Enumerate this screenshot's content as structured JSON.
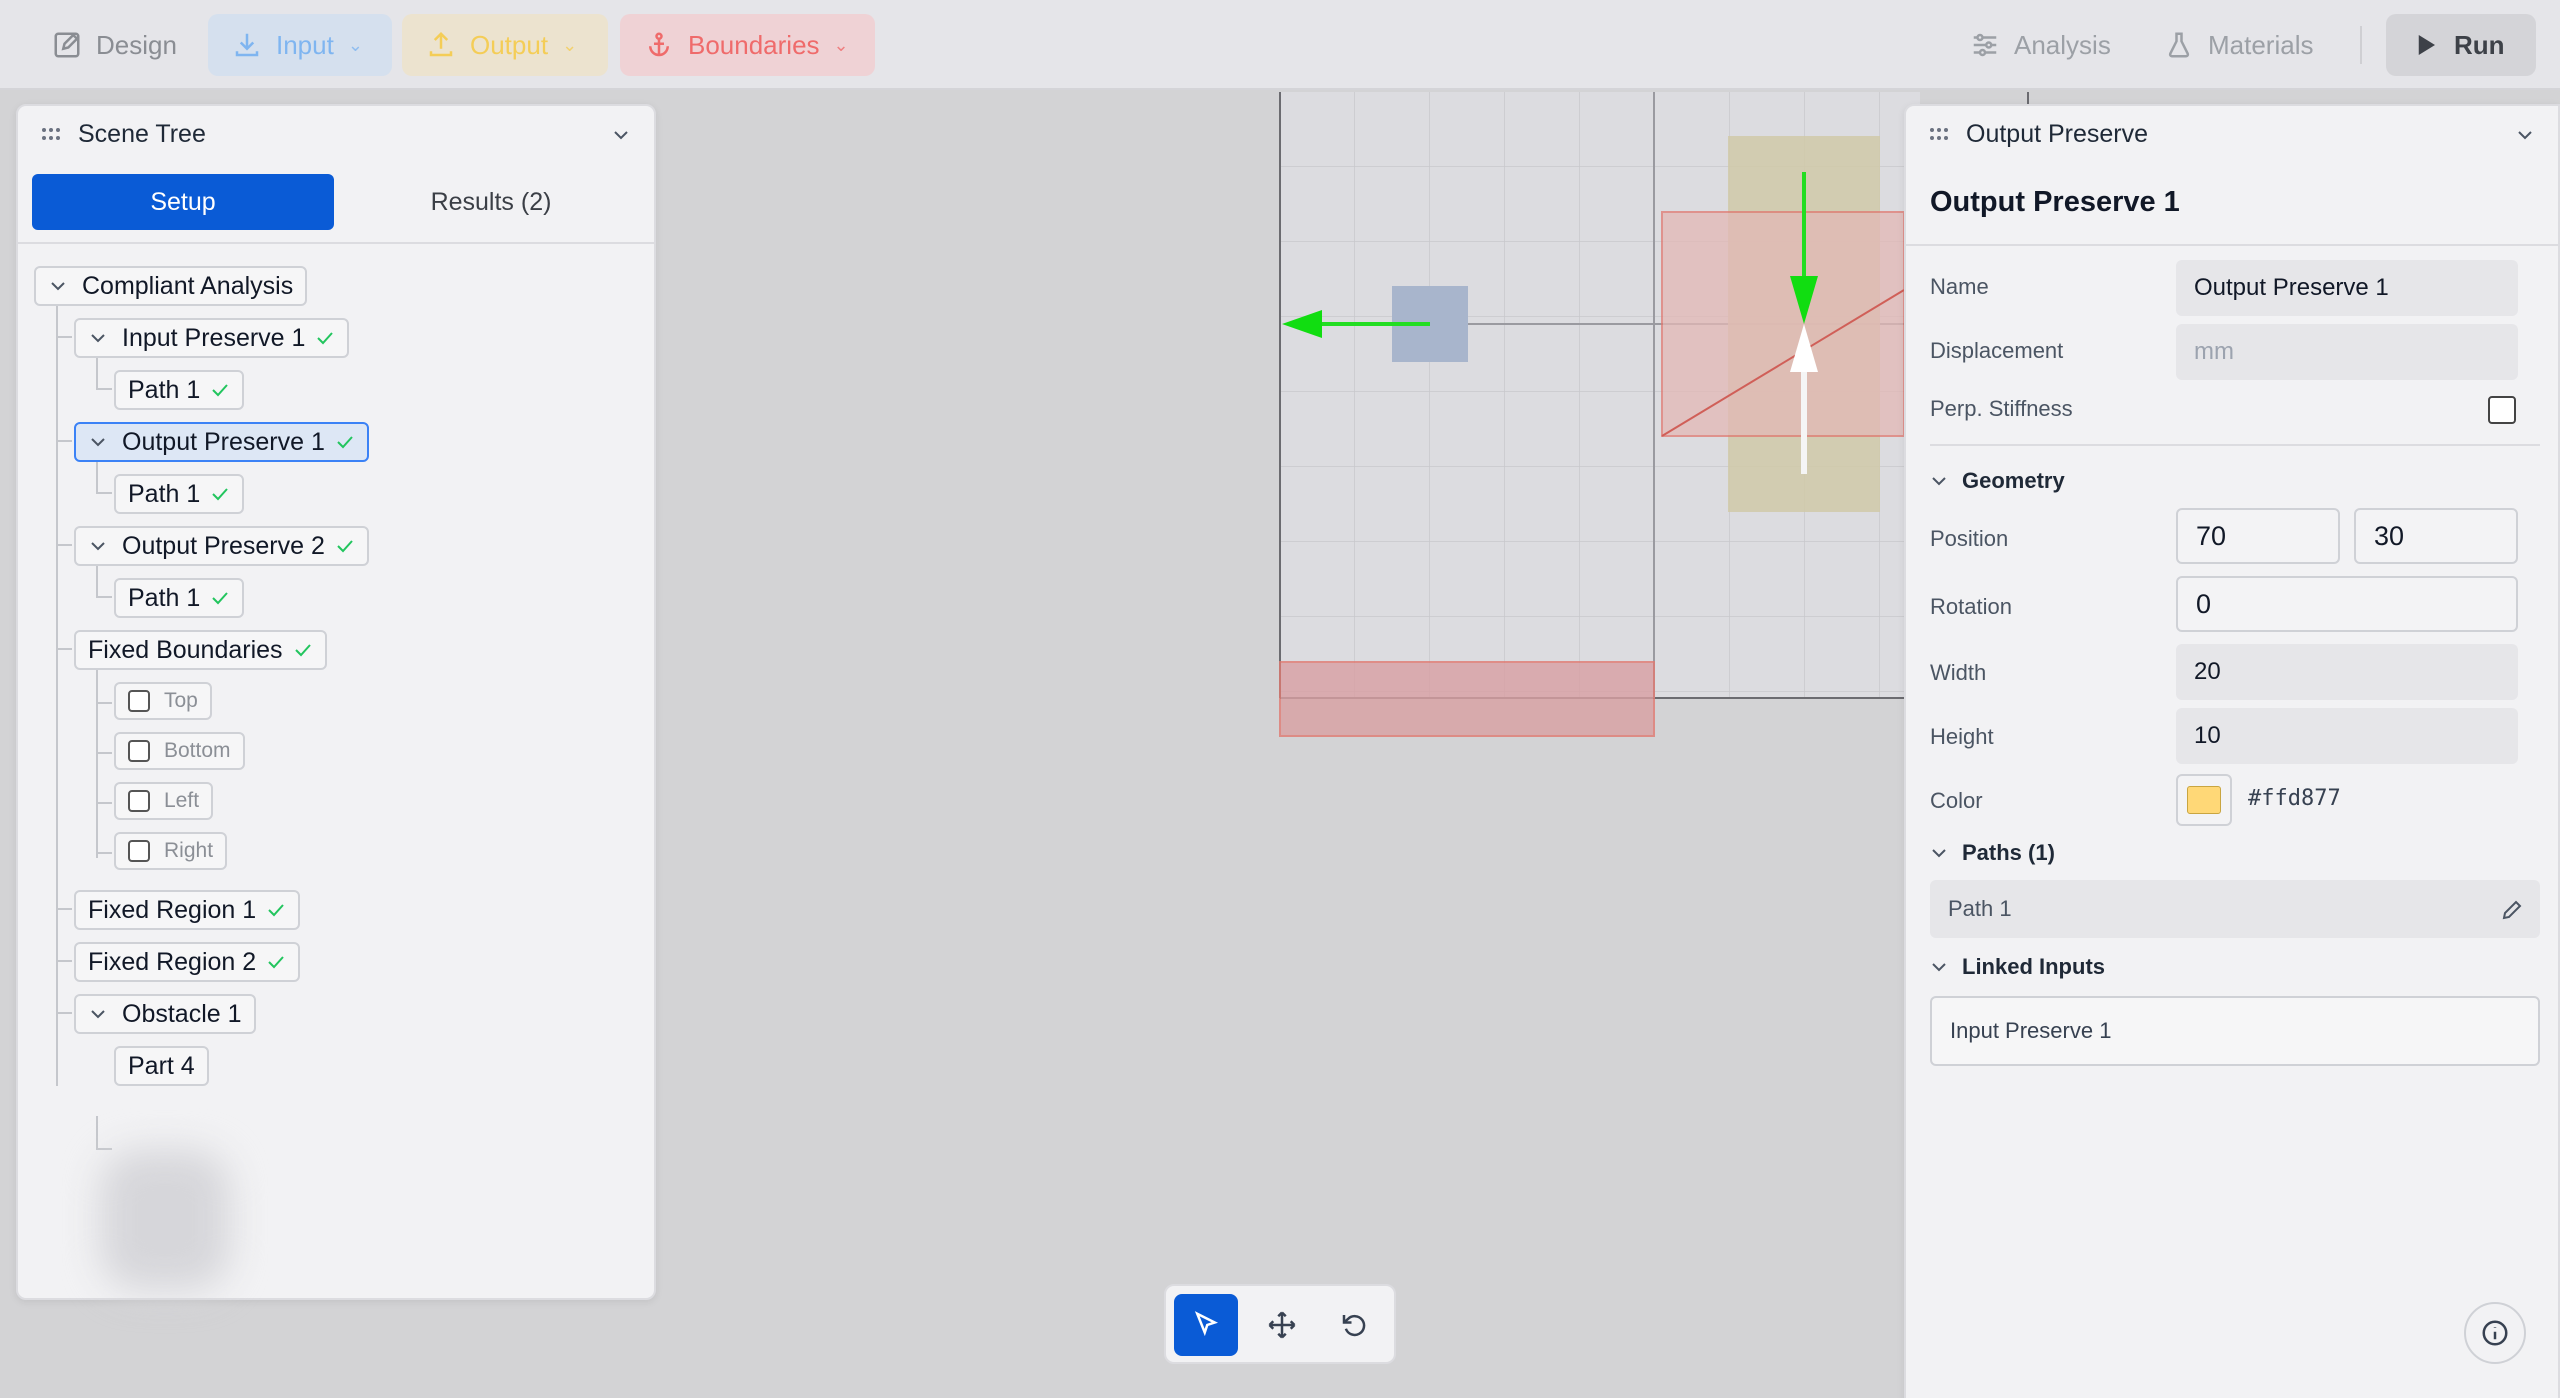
{
  "toolbar": {
    "design": "Design",
    "input": "Input",
    "output": "Output",
    "boundaries": "Boundaries",
    "analysis": "Analysis",
    "materials": "Materials",
    "run": "Run"
  },
  "scene_tree": {
    "title": "Scene Tree",
    "tabs": {
      "setup": "Setup",
      "results": "Results (2)"
    },
    "items": {
      "compliant": "Compliant Analysis",
      "input1": "Input Preserve 1",
      "input1_path": "Path 1",
      "output1": "Output Preserve 1",
      "output1_path": "Path 1",
      "output2": "Output Preserve 2",
      "output2_path": "Path 1",
      "fixed_boundaries": "Fixed Boundaries",
      "top": "Top",
      "bottom": "Bottom",
      "left": "Left",
      "right": "Right",
      "fixed_region1": "Fixed Region 1",
      "fixed_region2": "Fixed Region 2",
      "obstacle1": "Obstacle 1",
      "part4": "Part 4"
    }
  },
  "properties": {
    "panel_title": "Output Preserve",
    "title": "Output Preserve 1",
    "name_label": "Name",
    "name_value": "Output Preserve 1",
    "displacement_label": "Displacement",
    "displacement_placeholder": "mm",
    "perp_label": "Perp. Stiffness",
    "geometry_label": "Geometry",
    "position_label": "Position",
    "position_x": "70",
    "position_y": "30",
    "rotation_label": "Rotation",
    "rotation_value": "0",
    "width_label": "Width",
    "width_value": "20",
    "height_label": "Height",
    "height_value": "10",
    "color_label": "Color",
    "color_value": "#ffd877",
    "paths_label": "Paths (1)",
    "path1": "Path 1",
    "linked_label": "Linked Inputs",
    "linked_value": "Input Preserve 1"
  },
  "colors": {
    "accent": "#0a5bd6",
    "success": "#22c55e",
    "swatch": "#ffd877"
  }
}
